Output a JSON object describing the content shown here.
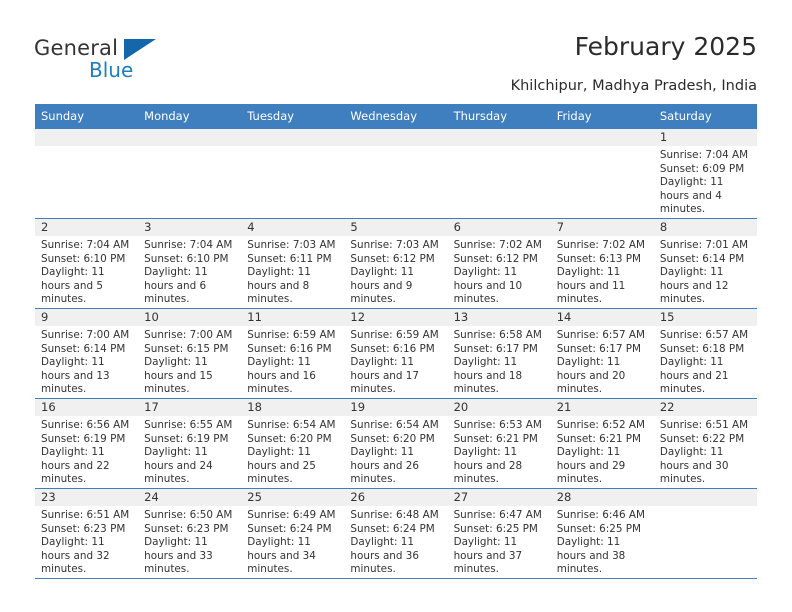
{
  "brand": {
    "name_top": "General",
    "name_bottom": "Blue",
    "accent_color": "#1a7fc1",
    "triangle_color": "#1567ab"
  },
  "header": {
    "title": "February 2025",
    "subtitle": "Khilchipur, Madhya Pradesh, India"
  },
  "theme": {
    "header_row_bg": "#3f7fbf",
    "header_row_text": "#ffffff",
    "daynum_bg": "#f0f0f0",
    "grid_line": "#3f7fbf",
    "body_text": "#333333"
  },
  "weekday_headers": [
    "Sunday",
    "Monday",
    "Tuesday",
    "Wednesday",
    "Thursday",
    "Friday",
    "Saturday"
  ],
  "labels": {
    "sunrise_prefix": "Sunrise:",
    "sunset_prefix": "Sunset:",
    "daylight_prefix": "Daylight:"
  },
  "weeks": [
    [
      {
        "day": "",
        "sunrise": "",
        "sunset": "",
        "daylight": "",
        "empty": true
      },
      {
        "day": "",
        "sunrise": "",
        "sunset": "",
        "daylight": "",
        "empty": true
      },
      {
        "day": "",
        "sunrise": "",
        "sunset": "",
        "daylight": "",
        "empty": true
      },
      {
        "day": "",
        "sunrise": "",
        "sunset": "",
        "daylight": "",
        "empty": true
      },
      {
        "day": "",
        "sunrise": "",
        "sunset": "",
        "daylight": "",
        "empty": true
      },
      {
        "day": "",
        "sunrise": "",
        "sunset": "",
        "daylight": "",
        "empty": true
      },
      {
        "day": "1",
        "sunrise": "Sunrise: 7:04 AM",
        "sunset": "Sunset: 6:09 PM",
        "daylight": "Daylight: 11 hours and 4 minutes.",
        "empty": false
      }
    ],
    [
      {
        "day": "2",
        "sunrise": "Sunrise: 7:04 AM",
        "sunset": "Sunset: 6:10 PM",
        "daylight": "Daylight: 11 hours and 5 minutes.",
        "empty": false
      },
      {
        "day": "3",
        "sunrise": "Sunrise: 7:04 AM",
        "sunset": "Sunset: 6:10 PM",
        "daylight": "Daylight: 11 hours and 6 minutes.",
        "empty": false
      },
      {
        "day": "4",
        "sunrise": "Sunrise: 7:03 AM",
        "sunset": "Sunset: 6:11 PM",
        "daylight": "Daylight: 11 hours and 8 minutes.",
        "empty": false
      },
      {
        "day": "5",
        "sunrise": "Sunrise: 7:03 AM",
        "sunset": "Sunset: 6:12 PM",
        "daylight": "Daylight: 11 hours and 9 minutes.",
        "empty": false
      },
      {
        "day": "6",
        "sunrise": "Sunrise: 7:02 AM",
        "sunset": "Sunset: 6:12 PM",
        "daylight": "Daylight: 11 hours and 10 minutes.",
        "empty": false
      },
      {
        "day": "7",
        "sunrise": "Sunrise: 7:02 AM",
        "sunset": "Sunset: 6:13 PM",
        "daylight": "Daylight: 11 hours and 11 minutes.",
        "empty": false
      },
      {
        "day": "8",
        "sunrise": "Sunrise: 7:01 AM",
        "sunset": "Sunset: 6:14 PM",
        "daylight": "Daylight: 11 hours and 12 minutes.",
        "empty": false
      }
    ],
    [
      {
        "day": "9",
        "sunrise": "Sunrise: 7:00 AM",
        "sunset": "Sunset: 6:14 PM",
        "daylight": "Daylight: 11 hours and 13 minutes.",
        "empty": false
      },
      {
        "day": "10",
        "sunrise": "Sunrise: 7:00 AM",
        "sunset": "Sunset: 6:15 PM",
        "daylight": "Daylight: 11 hours and 15 minutes.",
        "empty": false
      },
      {
        "day": "11",
        "sunrise": "Sunrise: 6:59 AM",
        "sunset": "Sunset: 6:16 PM",
        "daylight": "Daylight: 11 hours and 16 minutes.",
        "empty": false
      },
      {
        "day": "12",
        "sunrise": "Sunrise: 6:59 AM",
        "sunset": "Sunset: 6:16 PM",
        "daylight": "Daylight: 11 hours and 17 minutes.",
        "empty": false
      },
      {
        "day": "13",
        "sunrise": "Sunrise: 6:58 AM",
        "sunset": "Sunset: 6:17 PM",
        "daylight": "Daylight: 11 hours and 18 minutes.",
        "empty": false
      },
      {
        "day": "14",
        "sunrise": "Sunrise: 6:57 AM",
        "sunset": "Sunset: 6:17 PM",
        "daylight": "Daylight: 11 hours and 20 minutes.",
        "empty": false
      },
      {
        "day": "15",
        "sunrise": "Sunrise: 6:57 AM",
        "sunset": "Sunset: 6:18 PM",
        "daylight": "Daylight: 11 hours and 21 minutes.",
        "empty": false
      }
    ],
    [
      {
        "day": "16",
        "sunrise": "Sunrise: 6:56 AM",
        "sunset": "Sunset: 6:19 PM",
        "daylight": "Daylight: 11 hours and 22 minutes.",
        "empty": false
      },
      {
        "day": "17",
        "sunrise": "Sunrise: 6:55 AM",
        "sunset": "Sunset: 6:19 PM",
        "daylight": "Daylight: 11 hours and 24 minutes.",
        "empty": false
      },
      {
        "day": "18",
        "sunrise": "Sunrise: 6:54 AM",
        "sunset": "Sunset: 6:20 PM",
        "daylight": "Daylight: 11 hours and 25 minutes.",
        "empty": false
      },
      {
        "day": "19",
        "sunrise": "Sunrise: 6:54 AM",
        "sunset": "Sunset: 6:20 PM",
        "daylight": "Daylight: 11 hours and 26 minutes.",
        "empty": false
      },
      {
        "day": "20",
        "sunrise": "Sunrise: 6:53 AM",
        "sunset": "Sunset: 6:21 PM",
        "daylight": "Daylight: 11 hours and 28 minutes.",
        "empty": false
      },
      {
        "day": "21",
        "sunrise": "Sunrise: 6:52 AM",
        "sunset": "Sunset: 6:21 PM",
        "daylight": "Daylight: 11 hours and 29 minutes.",
        "empty": false
      },
      {
        "day": "22",
        "sunrise": "Sunrise: 6:51 AM",
        "sunset": "Sunset: 6:22 PM",
        "daylight": "Daylight: 11 hours and 30 minutes.",
        "empty": false
      }
    ],
    [
      {
        "day": "23",
        "sunrise": "Sunrise: 6:51 AM",
        "sunset": "Sunset: 6:23 PM",
        "daylight": "Daylight: 11 hours and 32 minutes.",
        "empty": false
      },
      {
        "day": "24",
        "sunrise": "Sunrise: 6:50 AM",
        "sunset": "Sunset: 6:23 PM",
        "daylight": "Daylight: 11 hours and 33 minutes.",
        "empty": false
      },
      {
        "day": "25",
        "sunrise": "Sunrise: 6:49 AM",
        "sunset": "Sunset: 6:24 PM",
        "daylight": "Daylight: 11 hours and 34 minutes.",
        "empty": false
      },
      {
        "day": "26",
        "sunrise": "Sunrise: 6:48 AM",
        "sunset": "Sunset: 6:24 PM",
        "daylight": "Daylight: 11 hours and 36 minutes.",
        "empty": false
      },
      {
        "day": "27",
        "sunrise": "Sunrise: 6:47 AM",
        "sunset": "Sunset: 6:25 PM",
        "daylight": "Daylight: 11 hours and 37 minutes.",
        "empty": false
      },
      {
        "day": "28",
        "sunrise": "Sunrise: 6:46 AM",
        "sunset": "Sunset: 6:25 PM",
        "daylight": "Daylight: 11 hours and 38 minutes.",
        "empty": false
      },
      {
        "day": "",
        "sunrise": "",
        "sunset": "",
        "daylight": "",
        "empty": true
      }
    ]
  ]
}
